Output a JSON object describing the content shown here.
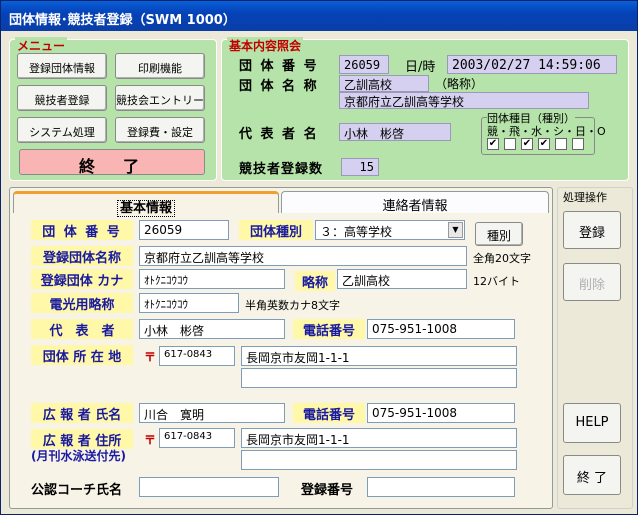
{
  "window_title": "団体情報･競技者登録（SWM 1000）",
  "menu": {
    "title": "メニュー",
    "buttons": [
      "登録団体情報",
      "印刷機能",
      "競技者登録",
      "競技会エントリー",
      "システム処理",
      "登録費・設定"
    ],
    "end_label": "終　了"
  },
  "basic": {
    "title": "基本内容照会",
    "group_no_label": "団 体 番 号",
    "group_no": "26059",
    "datetime_label": "日/時",
    "datetime": "2003/02/27 14:59:06",
    "group_name_label": "団 体 名 称",
    "group_short": "乙訓高校",
    "short_label": "（略称）",
    "group_full": "京都府立乙訓高等学校",
    "rep_label": "代 表 者 名",
    "rep": "小林　彬啓",
    "type_title": "団体種目（種別）",
    "type_items": "競・飛・水・シ・日・O",
    "type_checks": [
      "✔",
      "",
      "✔",
      "✔",
      "",
      ""
    ],
    "athletes_label": "競技者登録数",
    "athletes": "15"
  },
  "tabs": [
    "基本情報",
    "連絡者情報"
  ],
  "form": {
    "group_no_label": "団 体 番 号",
    "group_no": "26059",
    "group_type_label": "団体種別",
    "group_type": "３：高等学校",
    "type_btn": "種別",
    "reg_name_label": "登録団体名称",
    "reg_name": "京都府立乙訓高等学校",
    "reg_name_note": "全角20文字",
    "kana_label": "登録団体 カナ",
    "kana": "ｵﾄｸﾆｺｳｺｳ",
    "short_label": "略称",
    "short": "乙訓高校",
    "short_note": "12バイト",
    "elec_label": "電光用略称",
    "elec": "ｵﾄｸﾆｺｳｺｳ",
    "elec_note": "半角英数カナ8文字",
    "rep_label": "代　表　者",
    "rep": "小林　彬啓",
    "tel_label": "電話番号",
    "tel": "075-951-1008",
    "addr_label": "団体 所 在 地",
    "zip_mark": "〒",
    "zip": "617-0843",
    "addr1": "長岡京市友岡1-1-1",
    "addr2": "",
    "pr_name_label": "広 報 者 氏名",
    "pr_name": "川合　寛明",
    "pr_tel_label": "電話番号",
    "pr_tel": "075-951-1008",
    "pr_addr_label": "広 報 者 住所",
    "pr_addr_sub": "(月刊水泳送付先)",
    "pr_zip": "617-0843",
    "pr_addr1": "長岡京市友岡1-1-1",
    "pr_addr2": "",
    "coach_label": "公認コーチ氏名",
    "coach": "",
    "regno_label": "登録番号",
    "regno": ""
  },
  "ops": {
    "title": "処理操作",
    "register": "登録",
    "delete": "削除",
    "help": "HELP",
    "end": "終 了"
  }
}
